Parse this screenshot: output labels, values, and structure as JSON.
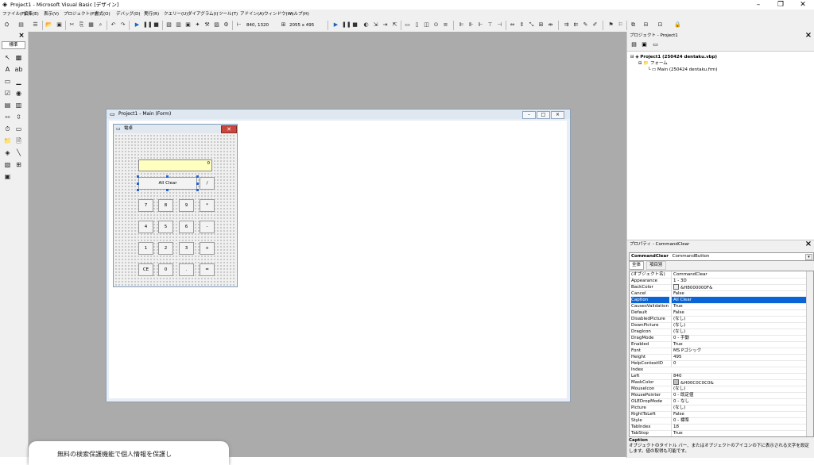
{
  "window": {
    "title": "Project1 - Microsoft Visual Basic [デザイン]",
    "minimize_icon": "minimize-icon",
    "maximize_icon": "restore-icon",
    "close_icon": "close-icon"
  },
  "menu": [
    "ファイル(F)",
    "編集(E)",
    "表示(V)",
    "プロジェクト(P)",
    "書式(O)",
    "デバッグ(D)",
    "実行(R)",
    "クエリー(U)",
    "ダイアグラム(I)",
    "ツール(T)",
    "アドイン(A)",
    "ウィンドウ(W)",
    "ヘルプ(H)"
  ],
  "toolbar": {
    "position": "840, 1320",
    "size": "2055 x 495"
  },
  "toolbox": {
    "title": "標準"
  },
  "designer": {
    "title": "Project1 - Main (Form)"
  },
  "calc_form": {
    "title": "電卓",
    "display_value": "0",
    "buttons": {
      "all_clear": "All Clear",
      "divide": "/",
      "seven": "7",
      "eight": "8",
      "nine": "9",
      "multiply": "*",
      "four": "4",
      "five": "5",
      "six": "6",
      "minus": "-",
      "one": "1",
      "two": "2",
      "three": "3",
      "plus": "+",
      "ce": "CE",
      "zero": "0",
      "dot": ".",
      "equals": "="
    }
  },
  "project_explorer": {
    "title": "プロジェクト - Project1",
    "project_node": "Project1 (250424 dentaku.vbp)",
    "forms_folder": "フォーム",
    "form_node": "Main (250424 dentaku.frm)"
  },
  "properties": {
    "title": "プロパティ - CommandClear",
    "object_name": "CommandClear",
    "object_type": "CommandButton",
    "tab_alpha": "全体",
    "tab_category": "項目別",
    "rows": [
      {
        "name": "(オブジェクト名)",
        "value": "CommandClear"
      },
      {
        "name": "Appearance",
        "value": "1 - 3D"
      },
      {
        "name": "BackColor",
        "value": "&H8000000F&",
        "swatch": "#f0f0f0"
      },
      {
        "name": "Cancel",
        "value": "False"
      },
      {
        "name": "Caption",
        "value": "All Clear",
        "selected": true
      },
      {
        "name": "CausesValidation",
        "value": "True"
      },
      {
        "name": "Default",
        "value": "False"
      },
      {
        "name": "DisabledPicture",
        "value": "(なし)"
      },
      {
        "name": "DownPicture",
        "value": "(なし)"
      },
      {
        "name": "DragIcon",
        "value": "(なし)"
      },
      {
        "name": "DragMode",
        "value": "0 - 手動"
      },
      {
        "name": "Enabled",
        "value": "True"
      },
      {
        "name": "Font",
        "value": "MS Pゴシック"
      },
      {
        "name": "Height",
        "value": "495"
      },
      {
        "name": "HelpContextID",
        "value": "0"
      },
      {
        "name": "Index",
        "value": ""
      },
      {
        "name": "Left",
        "value": "840"
      },
      {
        "name": "MaskColor",
        "value": "&H00C0C0C0&",
        "swatch": "#c0c0c0"
      },
      {
        "name": "MouseIcon",
        "value": "(なし)"
      },
      {
        "name": "MousePointer",
        "value": "0 - 既定値"
      },
      {
        "name": "OLEDropMode",
        "value": "0 - なし"
      },
      {
        "name": "Picture",
        "value": "(なし)"
      },
      {
        "name": "RightToLeft",
        "value": "False"
      },
      {
        "name": "Style",
        "value": "0 - 標準"
      },
      {
        "name": "TabIndex",
        "value": "18"
      },
      {
        "name": "TabStop",
        "value": "True"
      }
    ],
    "desc_title": "Caption",
    "desc_text": "オブジェクトのタイトル バー、またはオブジェクトのアイコンの下に表示される文字を設定します。値の取得も可能です。"
  },
  "notification": {
    "text": "無料の検索保護機能で個人情報を保護し"
  },
  "colors": {
    "workspace": "#ababab",
    "display_bg": "#ffffc0",
    "selection": "#0a64d6"
  }
}
